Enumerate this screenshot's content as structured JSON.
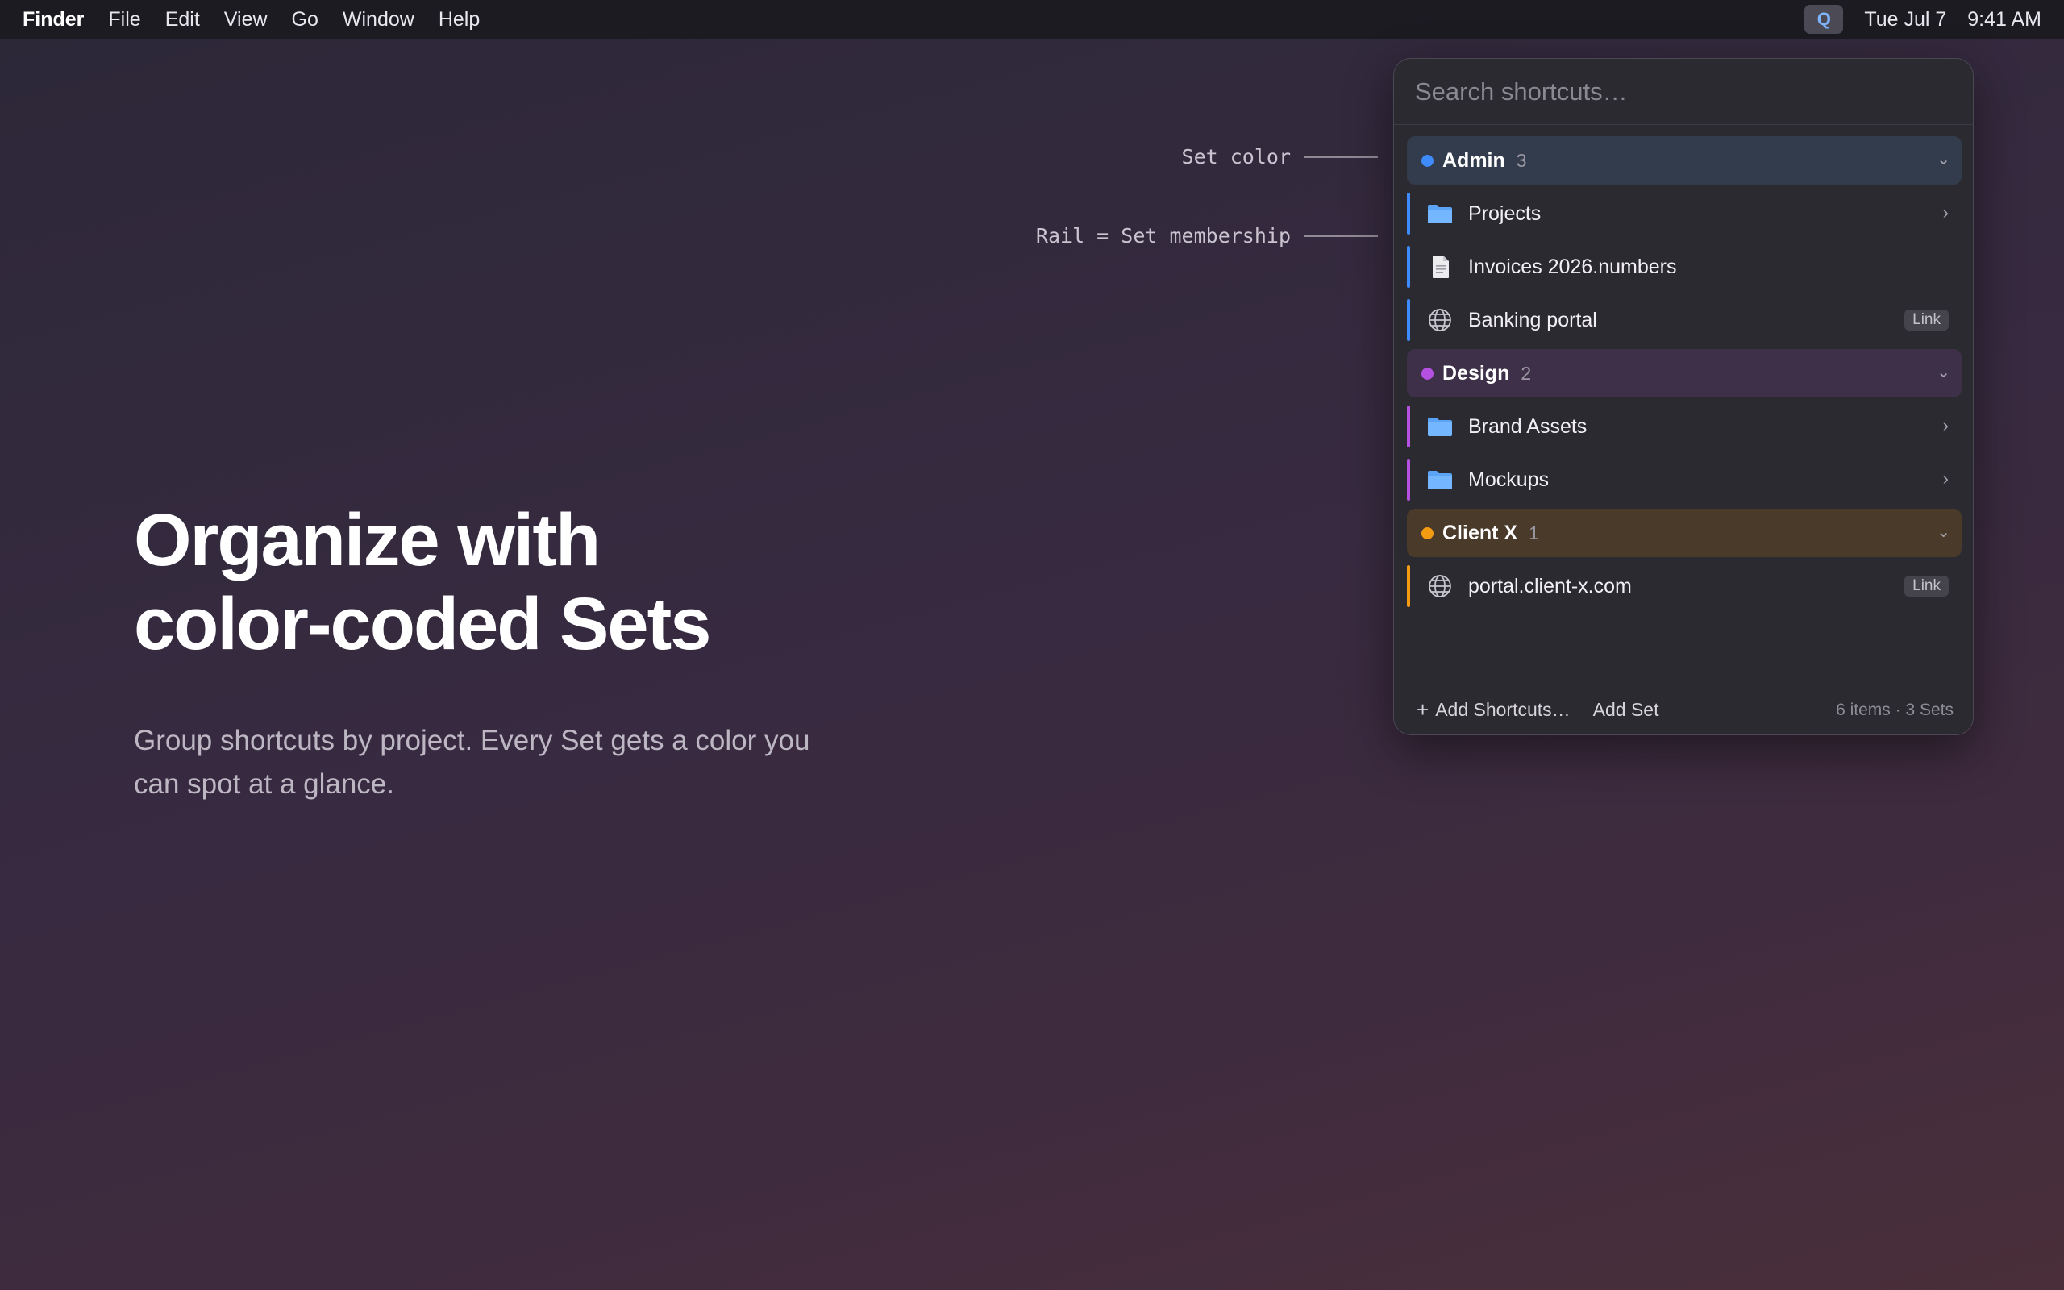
{
  "menubar": {
    "app_name": "Finder",
    "menus": [
      "File",
      "Edit",
      "View",
      "Go",
      "Window",
      "Help"
    ],
    "status_icon_letter": "Q",
    "date": "Tue Jul 7",
    "time": "9:41 AM"
  },
  "hero": {
    "title_line1": "Organize with",
    "title_line2": "color-coded Sets",
    "subtitle": "Group shortcuts by project. Every Set gets a color you can spot at a glance."
  },
  "annotations": {
    "set_color": "Set color",
    "rail": "Rail = Set membership"
  },
  "panel": {
    "search_placeholder": "Search shortcuts…",
    "sets": [
      {
        "name": "Admin",
        "count": "3",
        "color": "#3d8bfd",
        "header_bg": "#333c4d",
        "items": [
          {
            "label": "Projects",
            "icon": "folder-icon",
            "trailing": "chevron"
          },
          {
            "label": "Invoices 2026.numbers",
            "icon": "document-icon",
            "trailing": ""
          },
          {
            "label": "Banking portal",
            "icon": "globe-icon",
            "trailing": "Link"
          }
        ]
      },
      {
        "name": "Design",
        "count": "2",
        "color": "#b451e0",
        "header_bg": "#3f3049",
        "items": [
          {
            "label": "Brand Assets",
            "icon": "folder-icon",
            "trailing": "chevron"
          },
          {
            "label": "Mockups",
            "icon": "folder-icon",
            "trailing": "chevron"
          }
        ]
      },
      {
        "name": "Client X",
        "count": "1",
        "color": "#f39c12",
        "header_bg": "#4a3a29",
        "items": [
          {
            "label": "portal.client-x.com",
            "icon": "globe-icon",
            "trailing": "Link"
          }
        ]
      }
    ],
    "footer": {
      "add_shortcuts": "Add Shortcuts…",
      "add_set": "Add Set",
      "summary": "6 items · 3 Sets"
    }
  }
}
